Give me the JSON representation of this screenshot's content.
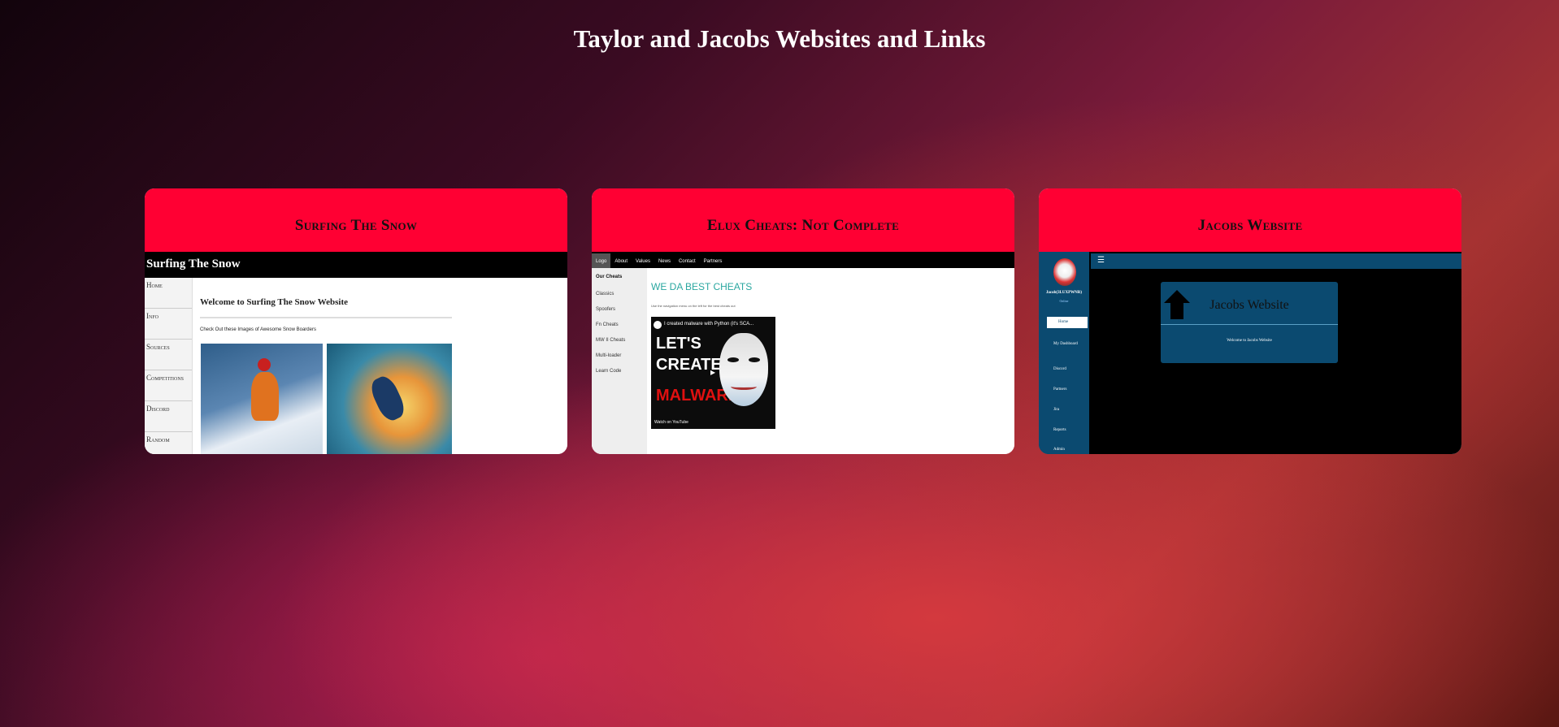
{
  "page": {
    "title": "Taylor and Jacobs Websites and Links"
  },
  "cards": [
    {
      "title": "Surfing The Snow",
      "preview": {
        "header": "Surfing The Snow",
        "nav": [
          "Home",
          "Info",
          "Sources",
          "Competitions",
          "Discord",
          "Random"
        ],
        "welcome": "Welcome to Surfing The Snow Website",
        "subtext": "Check Out these Images of Awesome Snow Boarders"
      }
    },
    {
      "title": "Elux Cheats: Not Complete",
      "preview": {
        "nav": [
          "Logo",
          "About",
          "Values",
          "News",
          "Contact",
          "Partners"
        ],
        "sidebar_title": "Our Cheats",
        "sidebar": [
          "Classics",
          "Spoofers",
          "Fn Cheats",
          "MW II Cheats",
          "Multi-loader",
          "Learn Code"
        ],
        "heading": "WE DA BEST CHEATS",
        "subtext": "Use the navigation menu on the left for the best cheats out",
        "video": {
          "title": "I created malware with Python (it's SCA...",
          "line1": "LET'S",
          "line2": "CREATE",
          "line3": "MALWARE",
          "watch": "Watch on YouTube"
        }
      }
    },
    {
      "title": "Jacobs Website",
      "preview": {
        "username": "Jacob(3LUXPWNR)",
        "status": "Online",
        "menu": [
          "Home",
          "My Dashboard",
          "Discord",
          "Partners",
          "Jira",
          "Reports",
          "Admin"
        ],
        "panel_title": "Jacobs Website",
        "panel_text": "Welcome to Jacobs Website"
      }
    }
  ]
}
